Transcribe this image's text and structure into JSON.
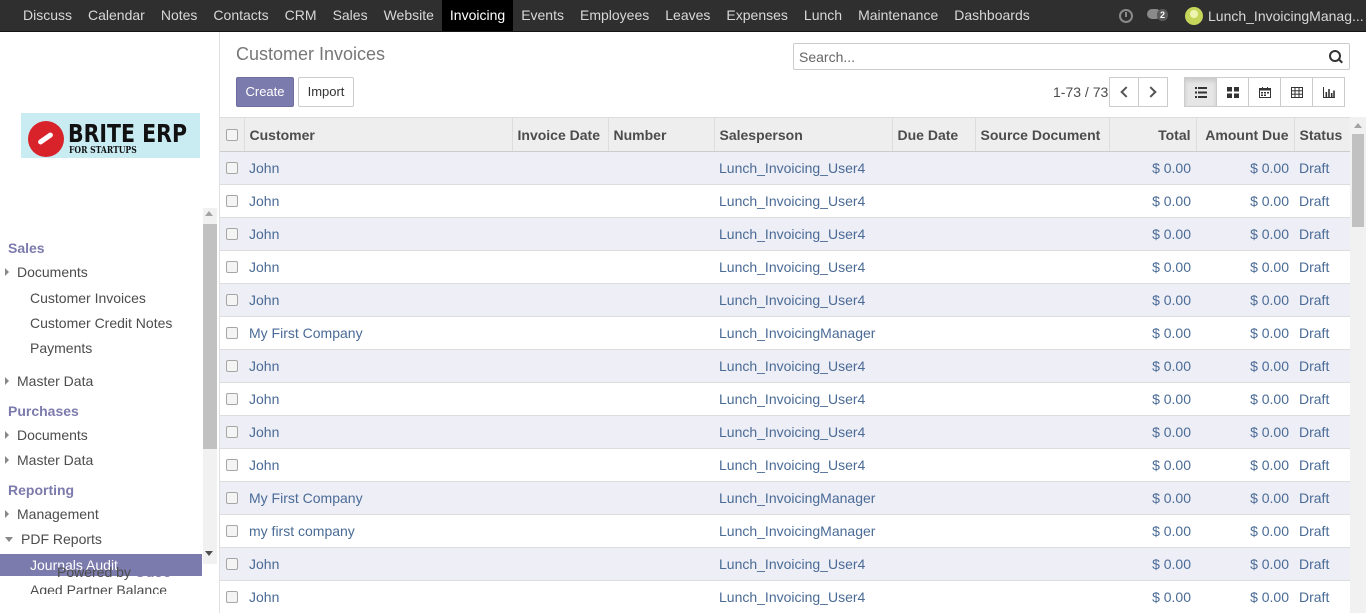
{
  "topbar": {
    "menu": [
      "Discuss",
      "Calendar",
      "Notes",
      "Contacts",
      "CRM",
      "Sales",
      "Website",
      "Invoicing",
      "Events",
      "Employees",
      "Leaves",
      "Expenses",
      "Lunch",
      "Maintenance",
      "Dashboards"
    ],
    "active": "Invoicing",
    "chat_count": "2",
    "user": "Lunch_InvoicingManag..."
  },
  "logo": {
    "brand": "BRITE ERP",
    "tagline": "FOR STARTUPS"
  },
  "sidebar": {
    "sales_title": "Sales",
    "sales_documents": "Documents",
    "customer_invoices": "Customer Invoices",
    "customer_credit_notes": "Customer Credit Notes",
    "payments": "Payments",
    "sales_master_data": "Master Data",
    "purchases_title": "Purchases",
    "purchases_documents": "Documents",
    "purchases_master_data": "Master Data",
    "reporting_title": "Reporting",
    "management": "Management",
    "pdf_reports": "PDF Reports",
    "journals_audit": "Journals Audit",
    "aged_partner_balance": "Aged Partner Balance",
    "powered_by": "Powered by",
    "odoo": "Odoo"
  },
  "control": {
    "title": "Customer Invoices",
    "search_placeholder": "Search...",
    "create": "Create",
    "import": "Import",
    "pager": "1-73 / 73"
  },
  "table": {
    "headers": [
      "Customer",
      "Invoice Date",
      "Number",
      "Salesperson",
      "Due Date",
      "Source Document",
      "Total",
      "Amount Due",
      "Status"
    ],
    "rows": [
      {
        "customer": "John",
        "salesperson": "Lunch_Invoicing_User4",
        "total": "$ 0.00",
        "due": "$ 0.00",
        "status": "Draft"
      },
      {
        "customer": "John",
        "salesperson": "Lunch_Invoicing_User4",
        "total": "$ 0.00",
        "due": "$ 0.00",
        "status": "Draft"
      },
      {
        "customer": "John",
        "salesperson": "Lunch_Invoicing_User4",
        "total": "$ 0.00",
        "due": "$ 0.00",
        "status": "Draft"
      },
      {
        "customer": "John",
        "salesperson": "Lunch_Invoicing_User4",
        "total": "$ 0.00",
        "due": "$ 0.00",
        "status": "Draft"
      },
      {
        "customer": "John",
        "salesperson": "Lunch_Invoicing_User4",
        "total": "$ 0.00",
        "due": "$ 0.00",
        "status": "Draft"
      },
      {
        "customer": "My First Company",
        "salesperson": "Lunch_InvoicingManager",
        "total": "$ 0.00",
        "due": "$ 0.00",
        "status": "Draft"
      },
      {
        "customer": "John",
        "salesperson": "Lunch_Invoicing_User4",
        "total": "$ 0.00",
        "due": "$ 0.00",
        "status": "Draft"
      },
      {
        "customer": "John",
        "salesperson": "Lunch_Invoicing_User4",
        "total": "$ 0.00",
        "due": "$ 0.00",
        "status": "Draft"
      },
      {
        "customer": "John",
        "salesperson": "Lunch_Invoicing_User4",
        "total": "$ 0.00",
        "due": "$ 0.00",
        "status": "Draft"
      },
      {
        "customer": "John",
        "salesperson": "Lunch_Invoicing_User4",
        "total": "$ 0.00",
        "due": "$ 0.00",
        "status": "Draft"
      },
      {
        "customer": "My First Company",
        "salesperson": "Lunch_InvoicingManager",
        "total": "$ 0.00",
        "due": "$ 0.00",
        "status": "Draft"
      },
      {
        "customer": "my first company",
        "salesperson": "Lunch_InvoicingManager",
        "total": "$ 0.00",
        "due": "$ 0.00",
        "status": "Draft"
      },
      {
        "customer": "John",
        "salesperson": "Lunch_Invoicing_User4",
        "total": "$ 0.00",
        "due": "$ 0.00",
        "status": "Draft"
      },
      {
        "customer": "John",
        "salesperson": "Lunch_Invoicing_User4",
        "total": "$ 0.00",
        "due": "$ 0.00",
        "status": "Draft"
      }
    ]
  },
  "colors": {
    "accent": "#7c7bad",
    "link": "#4a6b96",
    "navbar": "#2f2f2f",
    "row_stripe": "#eeeef6"
  },
  "icons": [
    "clock-icon",
    "chat-icon",
    "search-icon",
    "chevron-left-icon",
    "chevron-right-icon",
    "list-view-icon",
    "kanban-view-icon",
    "calendar-view-icon",
    "pivot-view-icon",
    "graph-view-icon"
  ]
}
